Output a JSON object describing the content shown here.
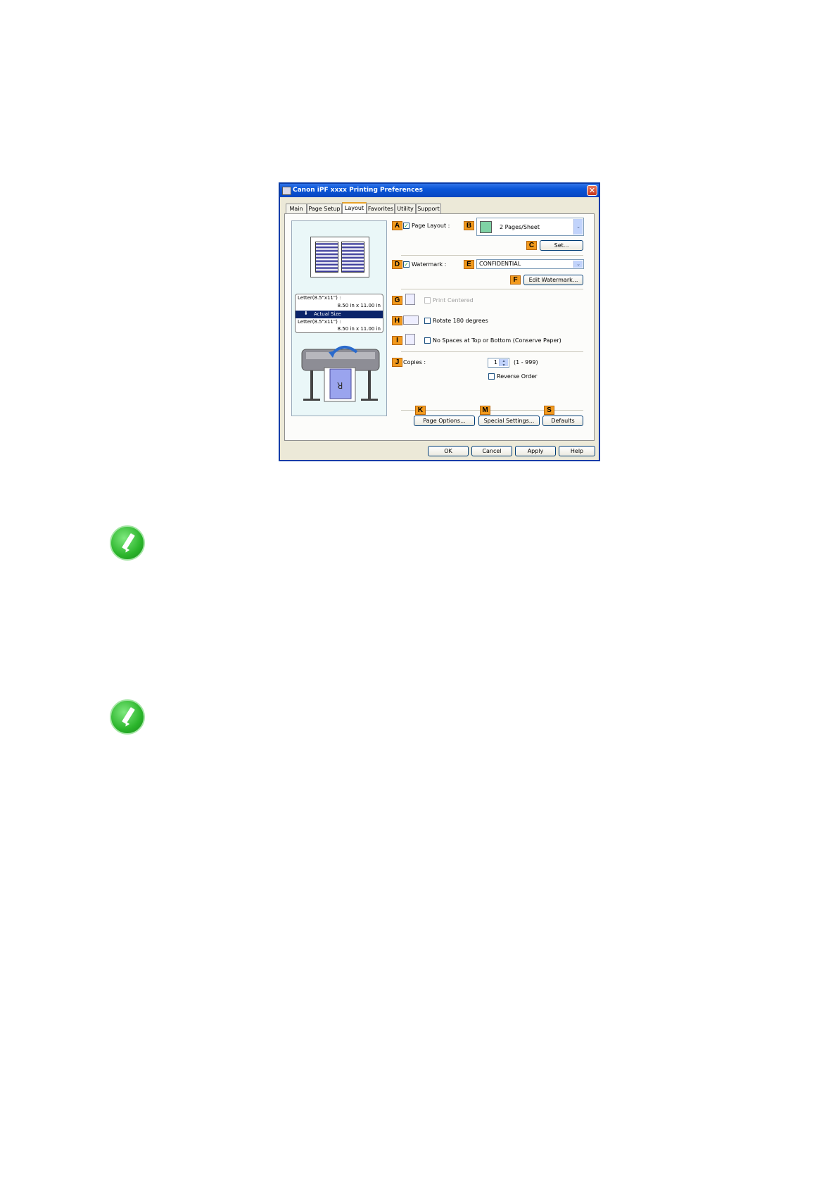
{
  "dialog": {
    "title": "Canon iPF xxxx Printing Preferences",
    "close_symbol": "✕",
    "tabs": [
      {
        "label": "Main"
      },
      {
        "label": "Page Setup"
      },
      {
        "label": "Layout"
      },
      {
        "label": "Favorites"
      },
      {
        "label": "Utility"
      },
      {
        "label": "Support"
      }
    ],
    "active_tab": "Layout",
    "preview": {
      "source_size_label": "Letter(8.5\"x11\") :",
      "source_size_dims": "8.50 in x 11.00 in",
      "scale_label": "Actual Size",
      "output_size_label": "Letter(8.5\"x11\") :",
      "output_size_dims": "8.50 in x 11.00 in",
      "print_letter": "R"
    },
    "markers": {
      "a": "A",
      "b": "B",
      "c": "C",
      "d": "D",
      "e": "E",
      "f": "F",
      "g": "G",
      "h": "H",
      "i": "I",
      "j": "J",
      "k": "K",
      "m": "M",
      "s": "S"
    },
    "page_layout": {
      "label": "Page Layout :",
      "checked": true,
      "value": "2 Pages/Sheet"
    },
    "set_button": "Set...",
    "watermark": {
      "label": "Watermark :",
      "checked": true,
      "value": "CONFIDENTIAL"
    },
    "edit_watermark_button": "Edit Watermark...",
    "print_centered": {
      "label": "Print Centered",
      "checked": false,
      "enabled": false
    },
    "rotate": {
      "label": "Rotate 180 degrees",
      "checked": false
    },
    "no_spaces": {
      "label": "No Spaces at Top or Bottom (Conserve Paper)",
      "checked": false
    },
    "copies": {
      "label": "Copies :",
      "value": "1",
      "range": "(1 - 999)"
    },
    "reverse_order": {
      "label": "Reverse Order",
      "checked": false
    },
    "page_options_button": "Page Options...",
    "special_settings_button": "Special Settings...",
    "defaults_button": "Defaults",
    "footer": {
      "ok": "OK",
      "cancel": "Cancel",
      "apply": "Apply",
      "help": "Help"
    }
  },
  "icons": {
    "note": "note-pencil-icon"
  },
  "colors": {
    "marker": "#f29a1e",
    "titlebar": "#0a55d8",
    "note": "#2bb52b"
  }
}
